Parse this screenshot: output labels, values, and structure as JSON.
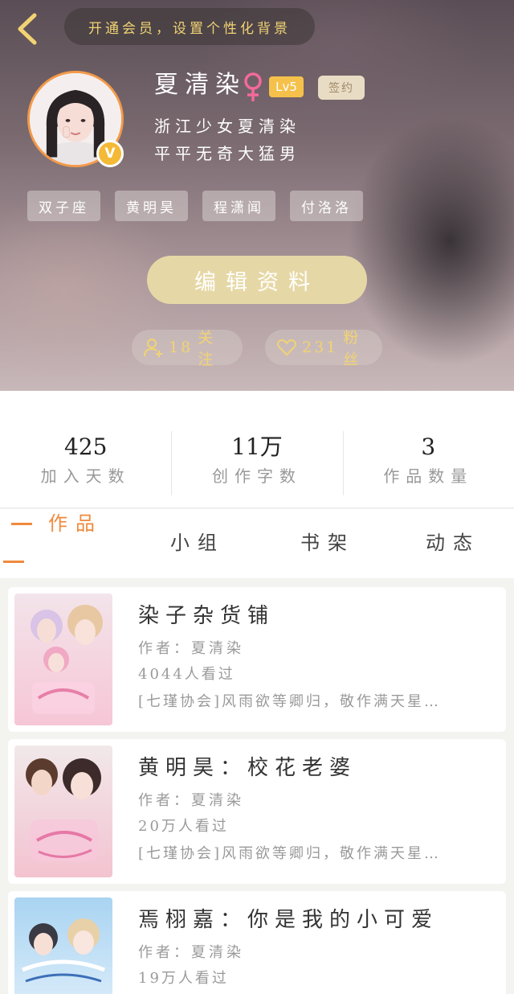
{
  "header": {
    "vip_banner": "开通会员，设置个性化背景",
    "avatar_badge": "V",
    "username": "夏清染",
    "level": "Lv5",
    "sign_badge": "签约",
    "bio_lines": [
      "浙江少女夏清染",
      "平平无奇大猛男"
    ],
    "tags": [
      "双子座",
      "黄明昊",
      "程潇闻",
      "付洛洛"
    ],
    "edit_button": "编辑资料",
    "follow": {
      "count": "18",
      "label": "关注"
    },
    "fans": {
      "count": "231",
      "label": "粉丝"
    }
  },
  "stats": [
    {
      "value": "425",
      "label": "加入天数"
    },
    {
      "value": "11万",
      "label": "创作字数"
    },
    {
      "value": "3",
      "label": "作品数量"
    }
  ],
  "tabs": [
    "作品",
    "小组",
    "书架",
    "动态"
  ],
  "active_tab": "作品",
  "books": [
    {
      "title": "染子杂货铺",
      "author": "作者：夏清染",
      "views": "4044人看过",
      "desc": "[七瑾协会]风雨欲等卿归，敬作满天星…"
    },
    {
      "title": "黄明昊：校花老婆",
      "author": "作者：夏清染",
      "views": "20万人看过",
      "desc": "[七瑾协会]风雨欲等卿归，敬作满天星…"
    },
    {
      "title": "焉栩嘉：你是我的小可爱",
      "author": "作者：夏清染",
      "views": "19万人看过",
      "desc": ""
    }
  ],
  "colors": {
    "accent": "#f08a3c",
    "gold": "#f1d373",
    "edit_button": "#e6d8a6",
    "level_badge": "#f5c14a"
  }
}
